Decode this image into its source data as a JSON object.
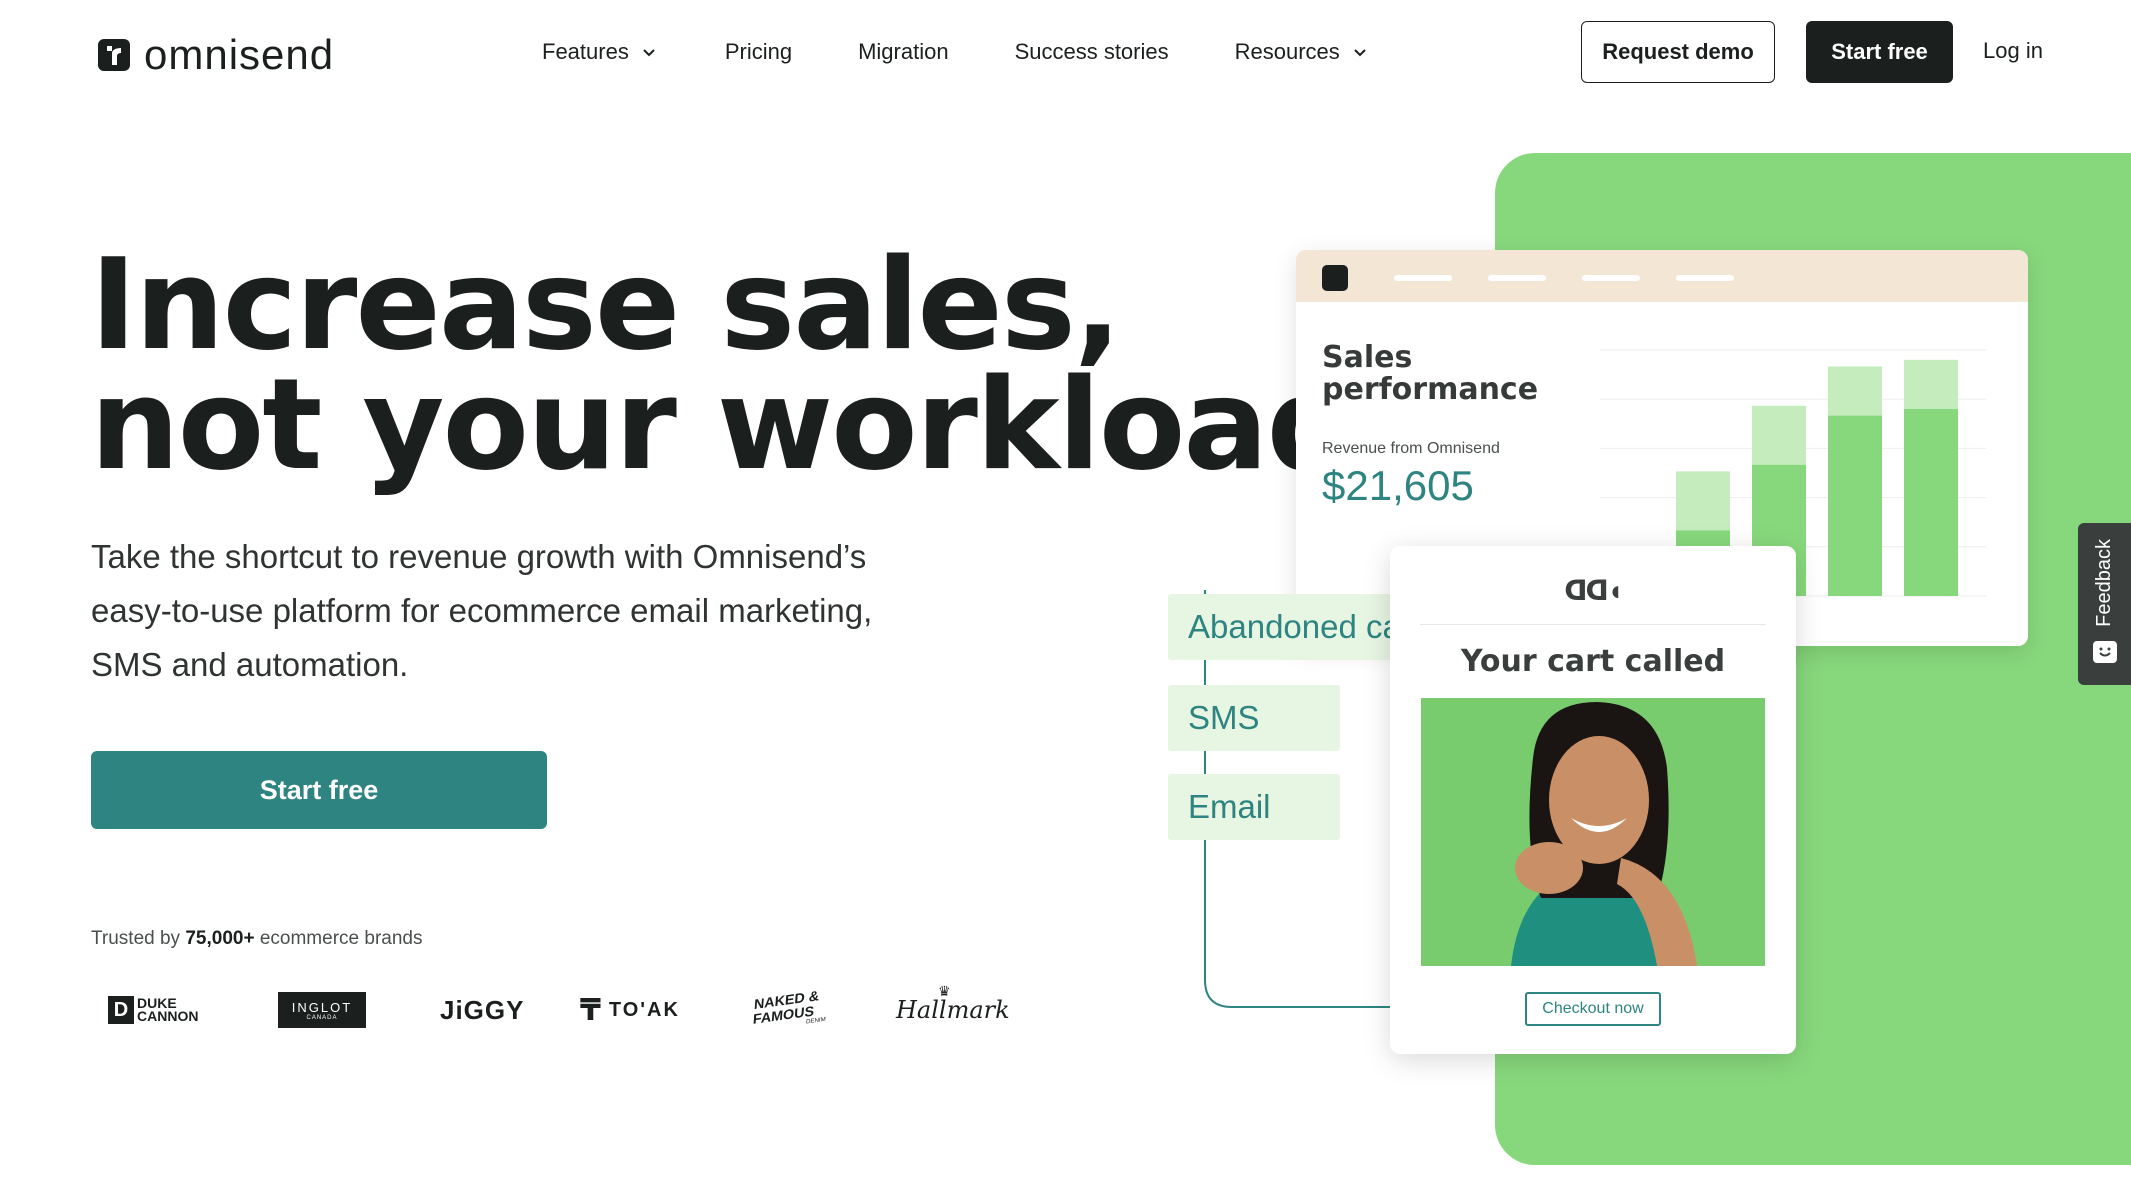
{
  "nav": {
    "logo_text": "omnisend",
    "items": [
      {
        "label": "Features",
        "dropdown": true
      },
      {
        "label": "Pricing",
        "dropdown": false
      },
      {
        "label": "Migration",
        "dropdown": false
      },
      {
        "label": "Success stories",
        "dropdown": false
      },
      {
        "label": "Resources",
        "dropdown": true
      }
    ],
    "request_demo": "Request demo",
    "start_free": "Start free",
    "login": "Log in"
  },
  "hero": {
    "headline_line1": "Increase sales,",
    "headline_line2": "not your workload",
    "subtext": "Take the shortcut to revenue growth with Omnisend’s easy-to-use platform for ecommerce email marketing, SMS and automation.",
    "cta": "Start free",
    "trusted_prefix": "Trusted by",
    "trusted_count": "75,000+",
    "trusted_suffix": "ecommerce brands"
  },
  "brands": [
    {
      "name": "DUKE CANNON",
      "icon": "duke-cannon-logo"
    },
    {
      "name": "INGLOT",
      "icon": "inglot-logo",
      "sub": "CANADA"
    },
    {
      "name": "JiGGY",
      "icon": "jiggy-logo"
    },
    {
      "name": "TO'AK",
      "icon": "toak-logo"
    },
    {
      "name": "NAKED & FAMOUS",
      "icon": "naked-famous-logo",
      "sub": "DENIM"
    },
    {
      "name": "Hallmark",
      "icon": "hallmark-logo"
    }
  ],
  "dashboard": {
    "title": "Sales performance",
    "revenue_label": "Revenue from Omnisend",
    "revenue_value": "$21,605",
    "chart_data": {
      "type": "bar",
      "stacked": true,
      "bars": [
        {
          "total": 0.13,
          "base": 0.04
        },
        {
          "total": 0.38,
          "base": 0.2
        },
        {
          "total": 0.58,
          "base": 0.4
        },
        {
          "total": 0.7,
          "base": 0.55
        },
        {
          "total": 0.72,
          "base": 0.57
        }
      ],
      "colors": {
        "base": "#87d87c",
        "top": "#c4ecbd"
      }
    }
  },
  "flow": {
    "chips": [
      "Abandoned cart",
      "SMS",
      "Email"
    ]
  },
  "email": {
    "brand_mark": "ᗡᗡ◖",
    "heading": "Your cart called",
    "button": "Checkout now"
  },
  "feedback": {
    "label": "Feedback"
  },
  "colors": {
    "accent": "#2e8481",
    "green": "#87d87c",
    "dark": "#1b1f1e"
  }
}
